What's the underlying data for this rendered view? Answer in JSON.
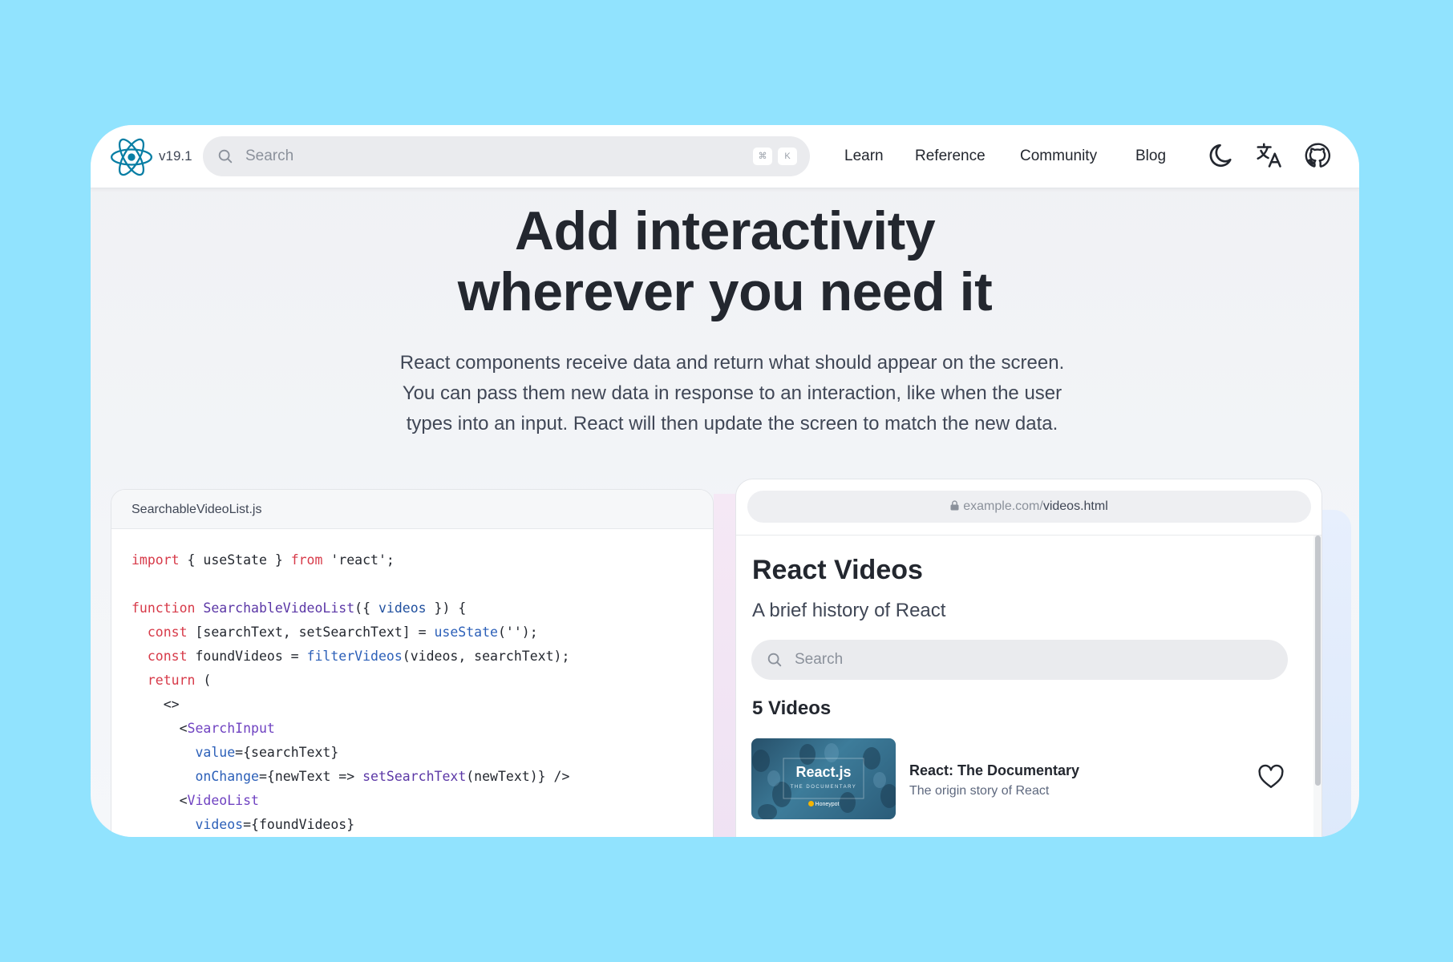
{
  "nav": {
    "version": "v19.1",
    "search_placeholder": "Search",
    "shortcut_key1": "⌘",
    "shortcut_key2": "K",
    "links": [
      "Learn",
      "Reference",
      "Community",
      "Blog"
    ],
    "icons": [
      "moon-icon",
      "translate-icon",
      "github-icon"
    ]
  },
  "hero": {
    "title_line1": "Add interactivity",
    "title_line2": "wherever you need it",
    "desc_line1": "React components receive data and return what should appear on the screen.",
    "desc_line2": "You can pass them new data in response to an interaction, like when the user",
    "desc_line3": "types into an input. React will then update the screen to match the new data."
  },
  "code": {
    "filename": "SearchableVideoList.js",
    "lines": [
      "import { useState } from 'react';",
      "",
      "function SearchableVideoList({ videos }) {",
      "  const [searchText, setSearchText] = useState('');",
      "  const foundVideos = filterVideos(videos, searchText);",
      "  return (",
      "    <>",
      "      <SearchInput",
      "        value={searchText}",
      "        onChange={newText => setSearchText(newText)} />",
      "      <VideoList",
      "        videos={foundVideos}"
    ]
  },
  "preview": {
    "url_domain": "example.com/",
    "url_path": "videos.html",
    "title": "React Videos",
    "subtitle": "A brief history of React",
    "search_placeholder": "Search",
    "videos_count": "5 Videos",
    "video": {
      "thumb_title": "React.js",
      "thumb_subtitle": "THE DOCUMENTARY",
      "thumb_brand": "Honeypot",
      "title": "React: The Documentary",
      "description": "The origin story of React"
    }
  },
  "colors": {
    "background": "#91e3fe",
    "react_blue": "#087ea4",
    "text": "#23272f"
  }
}
